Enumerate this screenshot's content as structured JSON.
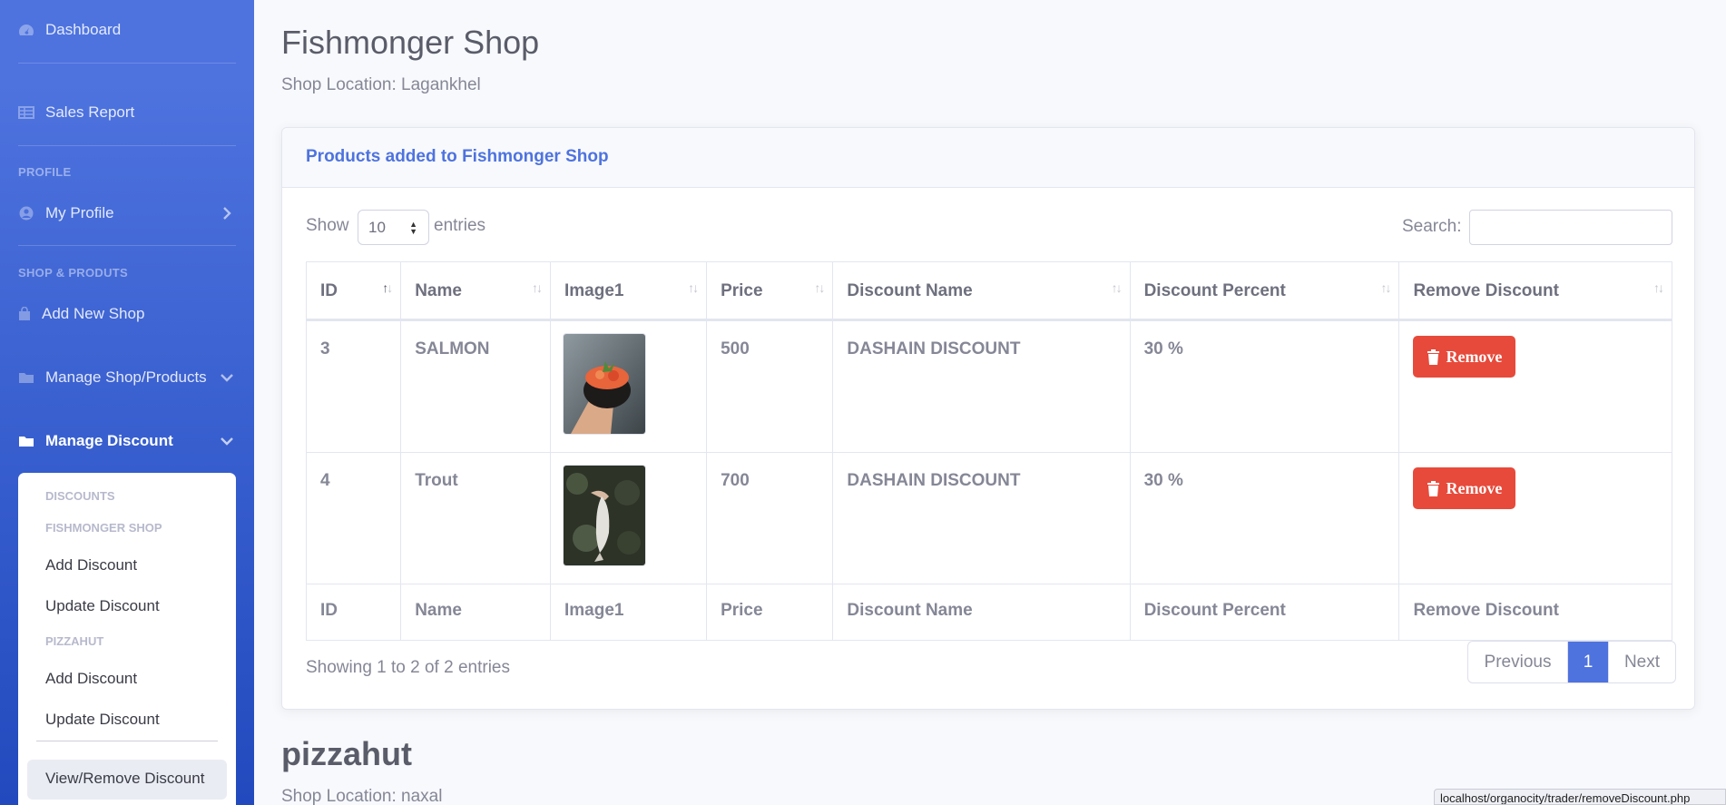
{
  "sidebar": {
    "dashboard": "Dashboard",
    "sales_report": "Sales Report",
    "profile_heading": "PROFILE",
    "my_profile": "My Profile",
    "shop_heading": "SHOP & PRODUTS",
    "add_new_shop": "Add New Shop",
    "manage_shop_products": "Manage Shop/Products",
    "manage_discount": "Manage Discount",
    "submenu": {
      "discounts_header": "DISCOUNTS",
      "fishmonger_header": "FISHMONGER SHOP",
      "fish_add": "Add Discount",
      "fish_update": "Update Discount",
      "pizzahut_header": "PIZZAHUT",
      "pizza_add": "Add Discount",
      "pizza_update": "Update Discount",
      "view_remove": "View/Remove Discount"
    }
  },
  "shop1": {
    "title": "Fishmonger Shop",
    "location": "Shop Location: Lagankhel",
    "card_title": "Products added to Fishmonger Shop",
    "show_label": "Show",
    "entries_value": "10",
    "entries_label": "entries",
    "search_label": "Search:",
    "search_value": "",
    "columns": [
      "ID",
      "Name",
      "Image1",
      "Price",
      "Discount Name",
      "Discount Percent",
      "Remove Discount"
    ],
    "rows": [
      {
        "id": "3",
        "name": "SALMON",
        "image": "salmon-dish",
        "price": "500",
        "discount_name": "DASHAIN DISCOUNT",
        "discount_percent": "30 %",
        "action": "Remove"
      },
      {
        "id": "4",
        "name": "Trout",
        "image": "trout-fish",
        "price": "700",
        "discount_name": "DASHAIN DISCOUNT",
        "discount_percent": "30 %",
        "action": "Remove"
      }
    ],
    "showing": "Showing 1 to 2 of 2 entries",
    "pagination": {
      "previous": "Previous",
      "current": "1",
      "next": "Next"
    }
  },
  "shop2": {
    "title": "pizzahut",
    "location": "Shop Location: naxal"
  },
  "status_url": "localhost/organocity/trader/removeDiscount.php",
  "colors": {
    "primary": "#4e73df",
    "danger": "#e74a3b",
    "sidebar_dark": "#224abe"
  }
}
